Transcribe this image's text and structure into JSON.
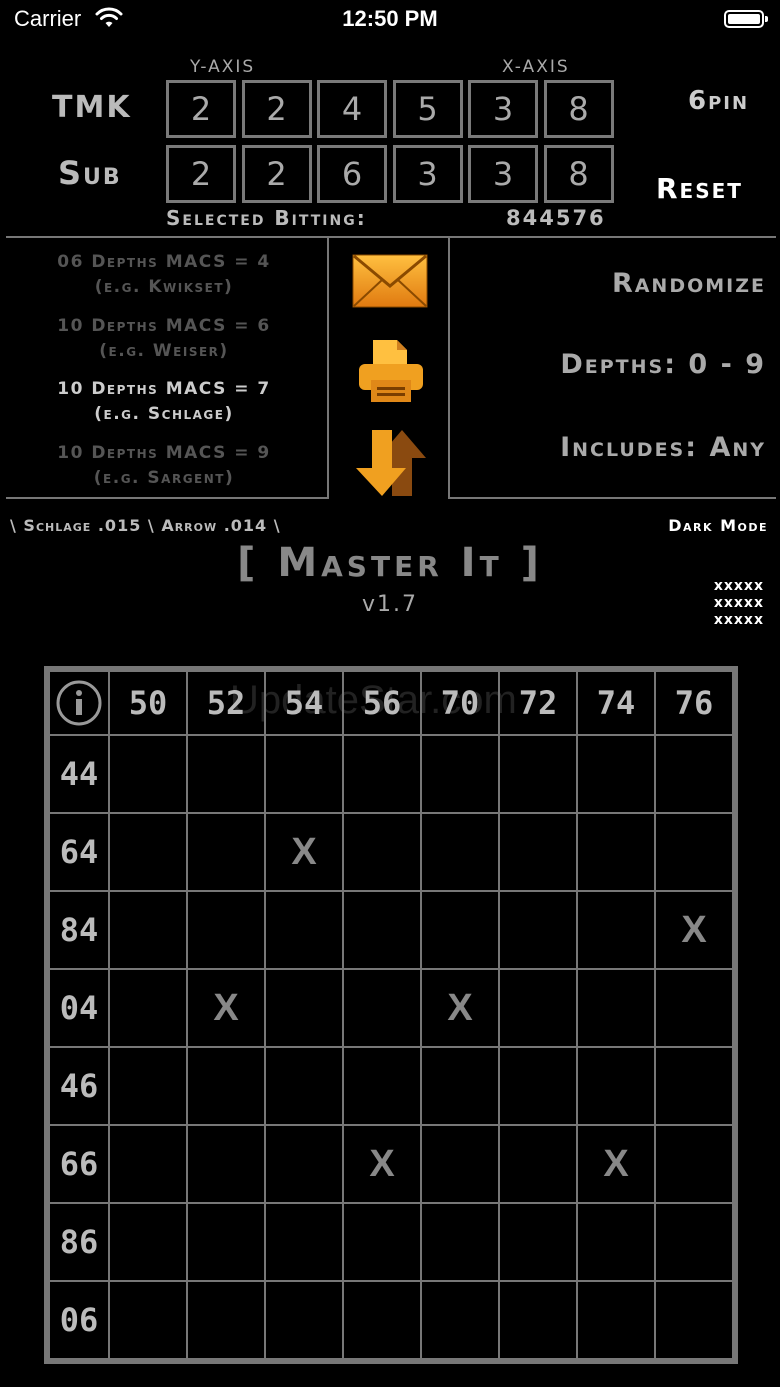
{
  "status_bar": {
    "carrier": "Carrier",
    "time": "12:50 PM"
  },
  "header": {
    "y_axis_label": "Y-AXIS",
    "x_axis_label": "X-AXIS",
    "tmk_label": "TMK",
    "sub_label": "Sub",
    "tmk_values": [
      "2",
      "2",
      "4",
      "5",
      "3",
      "8"
    ],
    "sub_values": [
      "2",
      "2",
      "6",
      "3",
      "3",
      "8"
    ],
    "pin_label": "6pin",
    "reset_label": "Reset",
    "selected_bitting_label": "Selected Bitting:",
    "selected_bitting_value": "844576"
  },
  "presets": [
    {
      "title": "06 Depths MACS = 4",
      "example": "(e.g. Kwikset)",
      "active": false
    },
    {
      "title": "10 Depths MACS = 6",
      "example": "(e.g. Weiser)",
      "active": false
    },
    {
      "title": "10 Depths MACS = 7",
      "example": "(e.g. Schlage)",
      "active": true
    },
    {
      "title": "10 Depths MACS = 9",
      "example": "(e.g. Sargent)",
      "active": false
    }
  ],
  "icons": {
    "mail": "envelope-icon",
    "print": "printer-icon",
    "swap": "swap-arrows-icon",
    "accent": "#F0A020"
  },
  "options": {
    "randomize": "Randomize",
    "depths": "Depths: 0 - 9",
    "includes": "Includes: Any"
  },
  "info_bar": {
    "spec": "\\ Schlage .015 \\ Arrow .014 \\",
    "dark_mode": "Dark Mode"
  },
  "app": {
    "title": "[ Master It ]",
    "version": "v1.7",
    "code_lines": [
      "xxxxx",
      "xxxxx",
      "xxxxx"
    ]
  },
  "grid": {
    "watermark": "UpdateStar.com",
    "columns": [
      "50",
      "52",
      "54",
      "56",
      "70",
      "72",
      "74",
      "76"
    ],
    "rows": [
      "44",
      "64",
      "84",
      "04",
      "46",
      "66",
      "86",
      "06"
    ],
    "marks": [
      {
        "row": 1,
        "col": 2,
        "text": "X"
      },
      {
        "row": 2,
        "col": 7,
        "text": "X"
      },
      {
        "row": 3,
        "col": 1,
        "text": "X"
      },
      {
        "row": 3,
        "col": 4,
        "text": "X"
      },
      {
        "row": 5,
        "col": 3,
        "text": "X"
      },
      {
        "row": 5,
        "col": 6,
        "text": "X"
      }
    ]
  }
}
